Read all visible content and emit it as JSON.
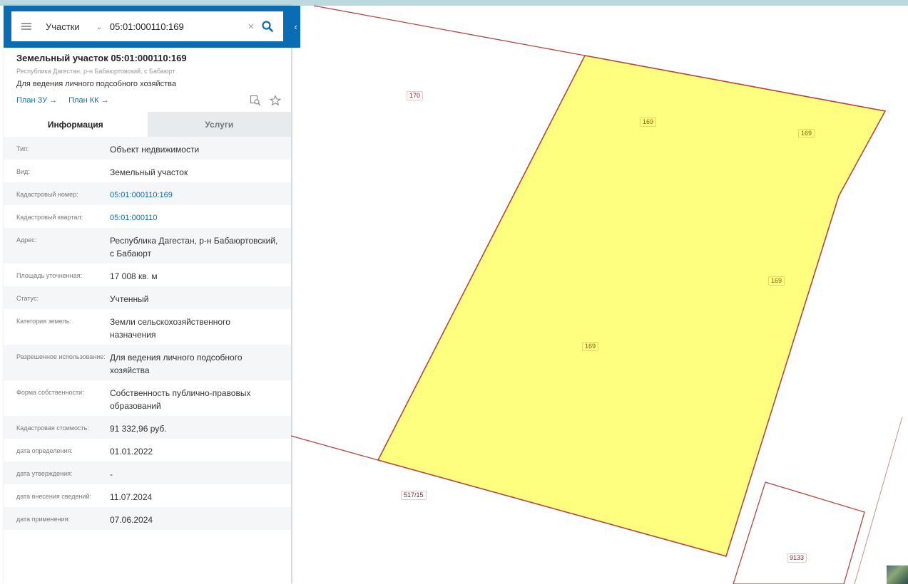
{
  "search": {
    "type_label": "Участки",
    "query": "05:01:000110:169"
  },
  "object": {
    "title": "Земельный участок 05:01:000110:169",
    "address": "Республика Дагестан, р-н Бабаюртовский, с Бабаюрт",
    "use": "Для ведения личного подсобного хозяйства",
    "links": [
      "План ЗУ",
      "План КК"
    ]
  },
  "tabs": [
    {
      "label": "Информация",
      "active": true
    },
    {
      "label": "Услуги",
      "active": false
    }
  ],
  "info_rows": [
    {
      "key": "Тип:",
      "value": "Объект недвижимости"
    },
    {
      "key": "Вид:",
      "value": "Земельный участок"
    },
    {
      "key": "Кадастровый номер:",
      "value": "05:01:000110:169"
    },
    {
      "key": "Кадастровый квартал:",
      "value": "05:01:000110"
    },
    {
      "key": "Адрес:",
      "value": "Республика Дагестан, р-н Бабаюртовский, с Бабаюрт"
    },
    {
      "key": "Площадь уточненная:",
      "value": "17 008 кв. м"
    },
    {
      "key": "Статус:",
      "value": "Учтенный"
    },
    {
      "key": "Категория земель:",
      "value": "Земли сельскохозяйственного назначения"
    },
    {
      "key": "Разрешенное использование:",
      "value": "Для ведения личного подсобного хозяйства"
    },
    {
      "key": "Форма собственности:",
      "value": "Собственность публично-правовых образований"
    },
    {
      "key": "Кадастровая стоимость:",
      "value": "91 332,96 руб."
    },
    {
      "key": "дата определения:",
      "value": "01.01.2022"
    },
    {
      "key": "дата утверждения:",
      "value": "-"
    },
    {
      "key": "дата внесения сведений:",
      "value": "11.07.2024"
    },
    {
      "key": "дата применения:",
      "value": "07.06.2024"
    }
  ],
  "map_labels": [
    "170",
    "169",
    "169",
    "169",
    "169",
    "517/15",
    "9133"
  ],
  "colors": {
    "accent": "#0a6cb3",
    "parcel_fill": "#ffff7f",
    "parcel_border": "#b5463f"
  }
}
